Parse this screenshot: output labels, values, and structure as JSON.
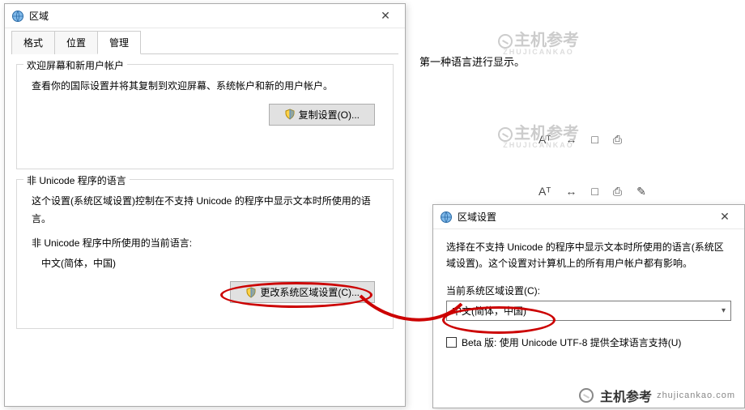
{
  "bg": {
    "line1": "第一种语言进行显示。",
    "icons1": [
      "Aᵀ",
      "↔",
      "□",
      "⎙"
    ],
    "icons2": [
      "Aᵀ",
      "↔",
      "□",
      "⎙",
      "✎"
    ]
  },
  "mainDialog": {
    "title": "区域",
    "tabs": [
      "格式",
      "位置",
      "管理"
    ],
    "activeTab": 2,
    "group1": {
      "legend": "欢迎屏幕和新用户帐户",
      "text": "查看你的国际设置并将其复制到欢迎屏幕、系统帐户和新的用户帐户。",
      "button": "复制设置(O)..."
    },
    "group2": {
      "legend": "非 Unicode 程序的语言",
      "text": "这个设置(系统区域设置)控制在不支持 Unicode 的程序中显示文本时所使用的语言。",
      "currentLabel": "非 Unicode 程序中所使用的当前语言:",
      "currentValue": "中文(简体，中国)",
      "button": "更改系统区域设置(C)..."
    }
  },
  "subDialog": {
    "title": "区域设置",
    "text": "选择在不支持 Unicode 的程序中显示文本时所使用的语言(系统区域设置)。这个设置对计算机上的所有用户帐户都有影响。",
    "comboLabel": "当前系统区域设置(C):",
    "comboValue": "中文(简体，中国)",
    "checkboxLabel": "Beta 版: 使用 Unicode UTF-8 提供全球语言支持(U)"
  },
  "watermarks": {
    "text": "主机参考",
    "sub": "ZHUJICANKAO",
    "url": "zhujicankao.com"
  }
}
